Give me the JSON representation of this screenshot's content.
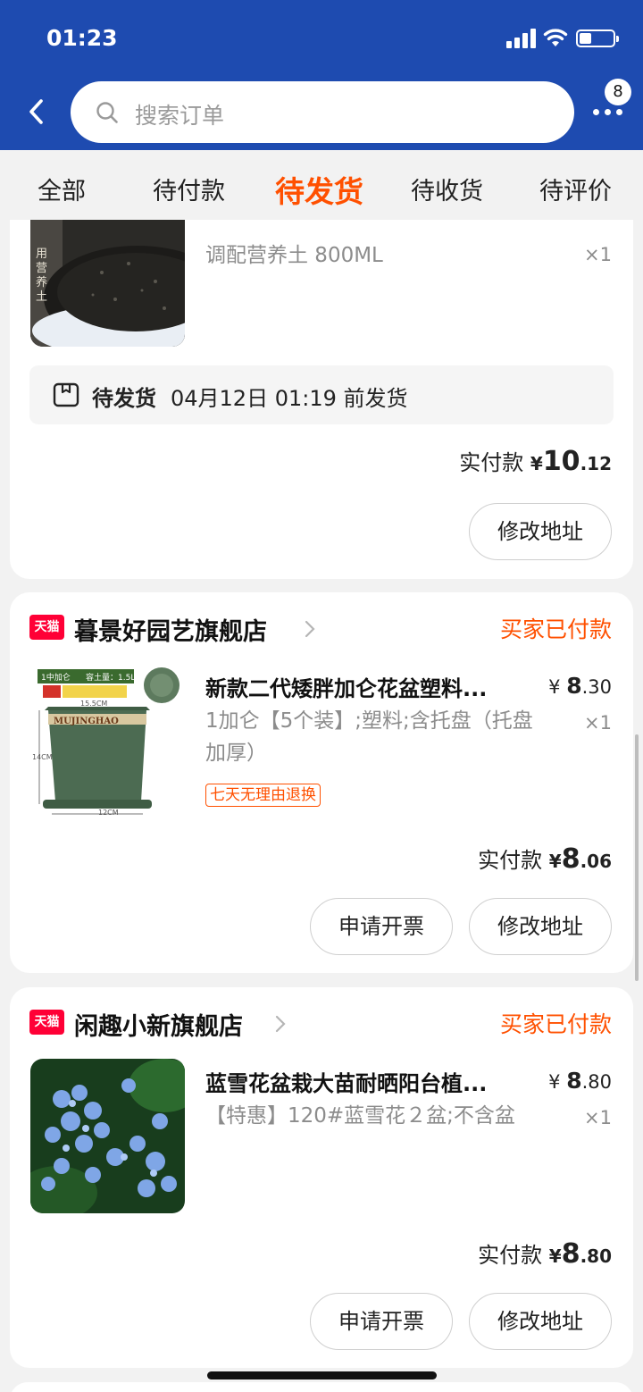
{
  "status_bar": {
    "time": "01:23"
  },
  "header": {
    "search_placeholder": "搜索订单",
    "more_badge": "8",
    "icons": [
      "back-icon",
      "search-icon",
      "more-icon"
    ],
    "brand_color": "#1e4bb0"
  },
  "tabs": [
    {
      "label": "全部",
      "active": false
    },
    {
      "label": "待付款",
      "active": false
    },
    {
      "label": "待发货",
      "active": true
    },
    {
      "label": "待收货",
      "active": false
    },
    {
      "label": "待评价",
      "active": false
    }
  ],
  "accent_color": "#ff5000",
  "orders": [
    {
      "thumb_caption": "用营养土",
      "sku": "调配营养土 800ML",
      "qty": "×1",
      "shipping": {
        "status": "待发货",
        "deadline": "04月12日 01:19 前发货"
      },
      "paid": {
        "label": "实付款",
        "currency": "¥",
        "int": "10",
        "dec": ".12"
      },
      "actions": [
        "修改地址"
      ]
    },
    {
      "store_logo": "天猫",
      "store_name": "暮景好园艺旗舰店",
      "store_status": "买家已付款",
      "title": "新款二代矮胖加仑花盆塑料...",
      "price": {
        "currency": "¥",
        "int": "8",
        "dec": ".30"
      },
      "sku": "1加仑【5个装】;塑料;含托盘（托盘加厚）",
      "qty": "×1",
      "tag": "七天无理由退换",
      "thumb_labels": {
        "top_left": "1中加仑",
        "top_right": "容土量：1.5L",
        "width": "15.5CM",
        "height": "14CM",
        "bottom": "12CM",
        "brand": "MUJINGHAO"
      },
      "paid": {
        "label": "实付款",
        "currency": "¥",
        "int": "8",
        "dec": ".06"
      },
      "actions": [
        "申请开票",
        "修改地址"
      ]
    },
    {
      "store_logo": "天猫",
      "store_name": "闲趣小新旗舰店",
      "store_status": "买家已付款",
      "title": "蓝雪花盆栽大苗耐晒阳台植...",
      "price": {
        "currency": "¥",
        "int": "8",
        "dec": ".80"
      },
      "sku": "【特惠】120#蓝雪花２盆;不含盆",
      "qty": "×1",
      "paid": {
        "label": "实付款",
        "currency": "¥",
        "int": "8",
        "dec": ".80"
      },
      "actions": [
        "申请开票",
        "修改地址"
      ]
    }
  ]
}
